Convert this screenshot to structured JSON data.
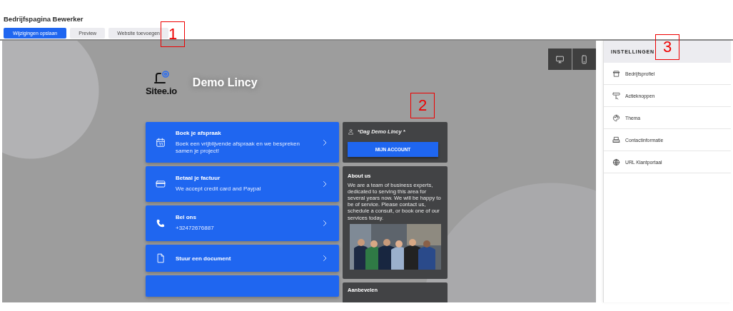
{
  "header": {
    "title": "Bedrijfspagina Bewerker",
    "buttons": [
      {
        "label": "Wijzigingen opslaan",
        "kind": "primary"
      },
      {
        "label": "Preview",
        "kind": "secondary"
      },
      {
        "label": "Website toevoegen",
        "kind": "secondary"
      }
    ]
  },
  "preview": {
    "logo_text": "Sitee.io",
    "site_name": "Demo Lincy",
    "devices": [
      {
        "kind": "desktop"
      },
      {
        "kind": "mobile"
      }
    ],
    "cards": [
      {
        "kind": "calendar",
        "title": "Boek je afspraak",
        "subtitle": "Boek een vrijblijvende afspraak en we bespreken samen je project!"
      },
      {
        "kind": "card",
        "title": "Betaal je factuur",
        "subtitle": "We accept credit card and Paypal"
      },
      {
        "kind": "phone",
        "title": "Bel ons",
        "subtitle": "+32472676887"
      },
      {
        "kind": "document",
        "title": "Stuur een document"
      }
    ],
    "more_cards_below": true,
    "account": {
      "greeting": "*Dag Demo Lincy *",
      "button": "MIJN ACCOUNT"
    },
    "about": {
      "title": "About us",
      "text": "We are a team of business experts, dedicated to serving this area for several years now. We will be happy to be of service. Please contact us, schedule a consult, or book one of our services today."
    },
    "recommend": {
      "title": "Aanbevelen"
    }
  },
  "settings": {
    "title": "INSTELLINGEN",
    "items": [
      {
        "kind": "store",
        "label": "Bedrijfsprofiel"
      },
      {
        "kind": "pointer",
        "label": "Actieknoppen"
      },
      {
        "kind": "palette",
        "label": "Thema"
      },
      {
        "kind": "printer",
        "label": "Contactinformatie"
      },
      {
        "kind": "globe",
        "label": "URL Klantportaal"
      }
    ]
  },
  "annotations": [
    {
      "label": "1"
    },
    {
      "label": "2"
    },
    {
      "label": "3"
    }
  ]
}
